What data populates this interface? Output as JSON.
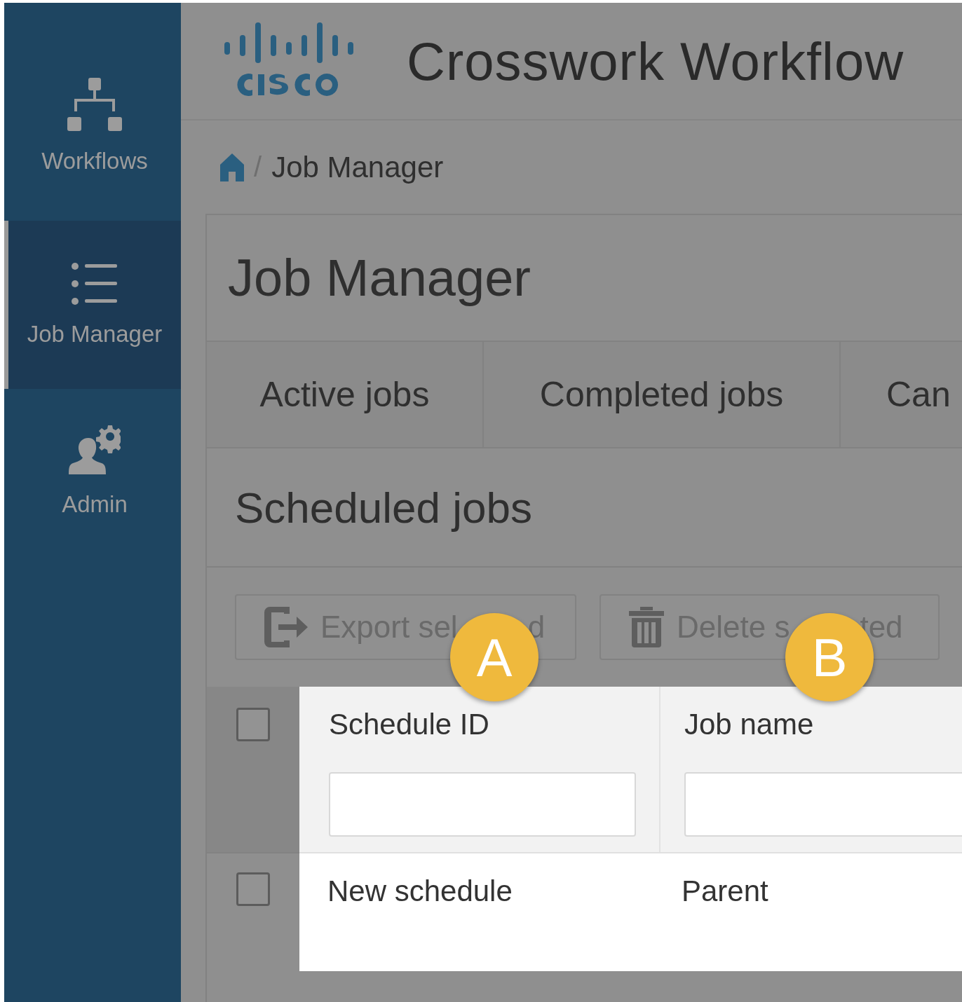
{
  "sidebar": {
    "items": [
      {
        "kind": "workflows",
        "label": "Workflows",
        "selected": false
      },
      {
        "kind": "jobs",
        "label": "Job Manager",
        "selected": true
      },
      {
        "kind": "admin",
        "label": "Admin",
        "selected": false
      }
    ]
  },
  "header": {
    "title": "Crosswork Workflow"
  },
  "breadcrumb": {
    "separator": "/",
    "current": "Job Manager"
  },
  "page": {
    "title": "Job Manager"
  },
  "tabs": [
    {
      "label": "Active jobs",
      "selected": false
    },
    {
      "label": "Completed jobs",
      "selected": false
    },
    {
      "label": "Can",
      "selected": false
    }
  ],
  "section": {
    "title": "Scheduled jobs"
  },
  "toolbar": {
    "buttons": [
      {
        "kind": "export",
        "label_parts": [
          "Export sel",
          "d"
        ]
      },
      {
        "kind": "delete",
        "label_parts": [
          "Delete s",
          "ted"
        ]
      }
    ]
  },
  "table": {
    "select_all": {
      "checked": false
    },
    "columns": [
      {
        "label": "Schedule ID",
        "callout": "A"
      },
      {
        "label": "Job name",
        "callout": "B"
      }
    ],
    "rows": [
      {
        "checked": false,
        "cells": [
          "New schedule",
          "Parent"
        ]
      }
    ]
  }
}
